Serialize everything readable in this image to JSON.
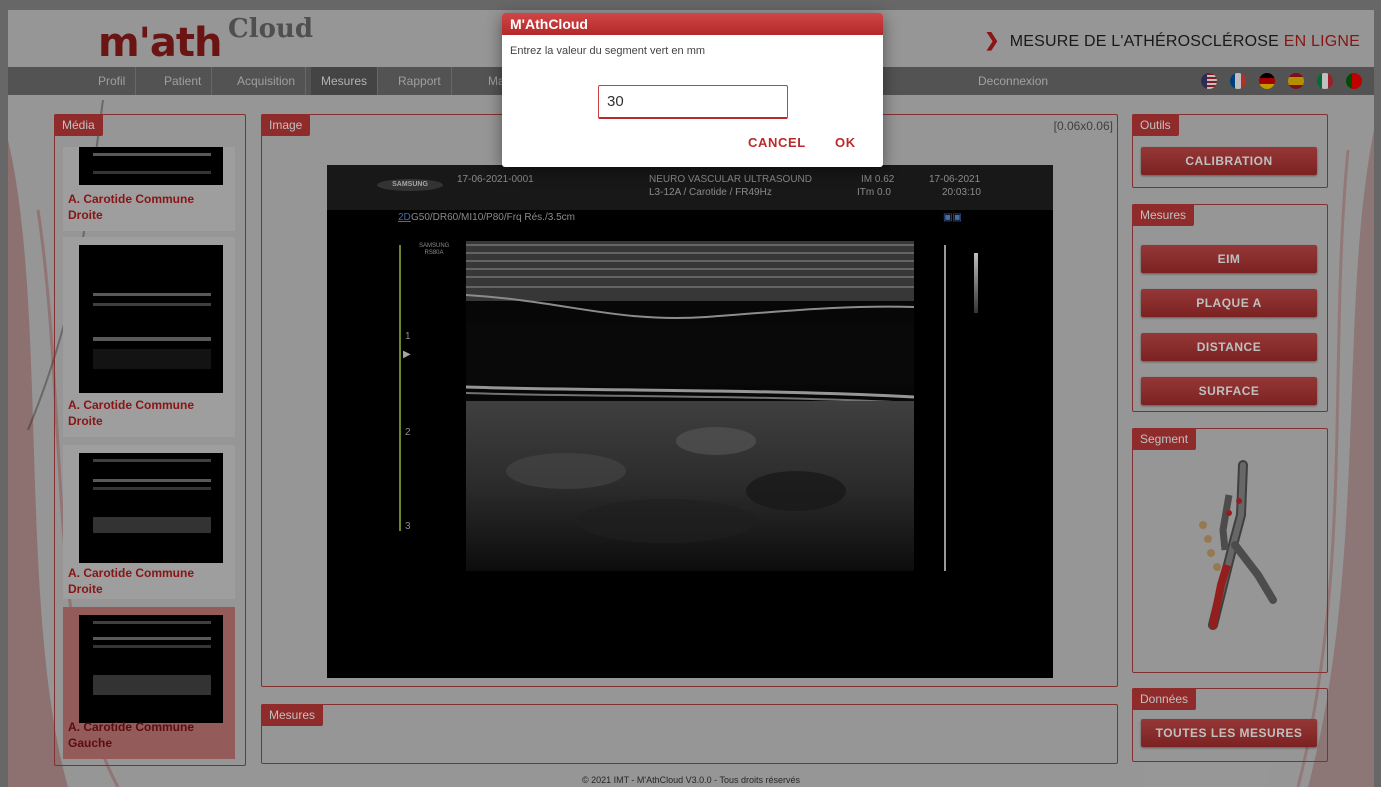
{
  "header": {
    "logo_text": "m'ath",
    "logo_suffix": "Cloud",
    "tagline_main": "MESURE DE L'ATHÉROSCLÉROSE",
    "tagline_highlight": "EN LIGNE"
  },
  "nav": {
    "items": [
      "Profil",
      "Patient",
      "Acquisition",
      "Mesures",
      "Rapport",
      "Ma"
    ],
    "active": "Mesures",
    "logout": "Deconnexion",
    "languages": [
      {
        "icon": "us-flag-icon",
        "colors": [
          "#b22234",
          "#ffffff",
          "#3c3b6e"
        ]
      },
      {
        "icon": "fr-flag-icon",
        "colors": [
          "#0055a4",
          "#ffffff",
          "#ef4135"
        ]
      },
      {
        "icon": "de-flag-icon",
        "colors": [
          "#000000",
          "#dd0000",
          "#ffce00"
        ]
      },
      {
        "icon": "es-flag-icon",
        "colors": [
          "#aa151b",
          "#f1bf00",
          "#aa151b"
        ]
      },
      {
        "icon": "it-flag-icon",
        "colors": [
          "#009246",
          "#ffffff",
          "#ce2b37"
        ]
      },
      {
        "icon": "pt-flag-icon",
        "colors": [
          "#006600",
          "#ff0000",
          "#ff0000"
        ]
      }
    ]
  },
  "media": {
    "title": "Média",
    "items": [
      {
        "label_line1": "A. Carotide Commune",
        "label_line2": "Droite",
        "selected": false
      },
      {
        "label_line1": "A. Carotide Commune",
        "label_line2": "Droite",
        "selected": false
      },
      {
        "label_line1": "A. Carotide Commune",
        "label_line2": "Droite",
        "selected": false
      },
      {
        "label_line1": "A. Carotide Commune",
        "label_line2": "Gauche",
        "selected": true
      }
    ]
  },
  "image": {
    "title": "Image",
    "pixel_size": "[0.06x0.06]",
    "overlay": {
      "brand": "SAMSUNG",
      "exam_id": "17-06-2021-0001",
      "mode": "NEURO VASCULAR ULTRASOUND",
      "probe": "L3-12A / Carotide / FR49Hz",
      "im": "IM 0.62",
      "itm": "ITm 0.0",
      "date": "17-06-2021",
      "time": "20:03:10",
      "mode_2d": "2D",
      "params": "G50/DR60/MI10/P80/Frq Rés./3.5cm",
      "model": "SAMSUNG RS80A",
      "depth_ticks": [
        "1",
        "2",
        "3"
      ]
    }
  },
  "mesures_bottom": {
    "title": "Mesures"
  },
  "outils": {
    "title": "Outils",
    "calibration": "CALIBRATION"
  },
  "mesures": {
    "title": "Mesures",
    "buttons": [
      "EIM",
      "PLAQUE A",
      "DISTANCE",
      "SURFACE"
    ]
  },
  "segment": {
    "title": "Segment"
  },
  "donnees": {
    "title": "Données",
    "all_measures": "TOUTES LES MESURES"
  },
  "footer": "© 2021 IMT - M'AthCloud V3.0.0 - Tous droits réservés",
  "dialog": {
    "title": "M'AthCloud",
    "message": "Entrez la valeur du segment vert en mm",
    "input_value": "30",
    "cancel": "CANCEL",
    "ok": "OK"
  }
}
